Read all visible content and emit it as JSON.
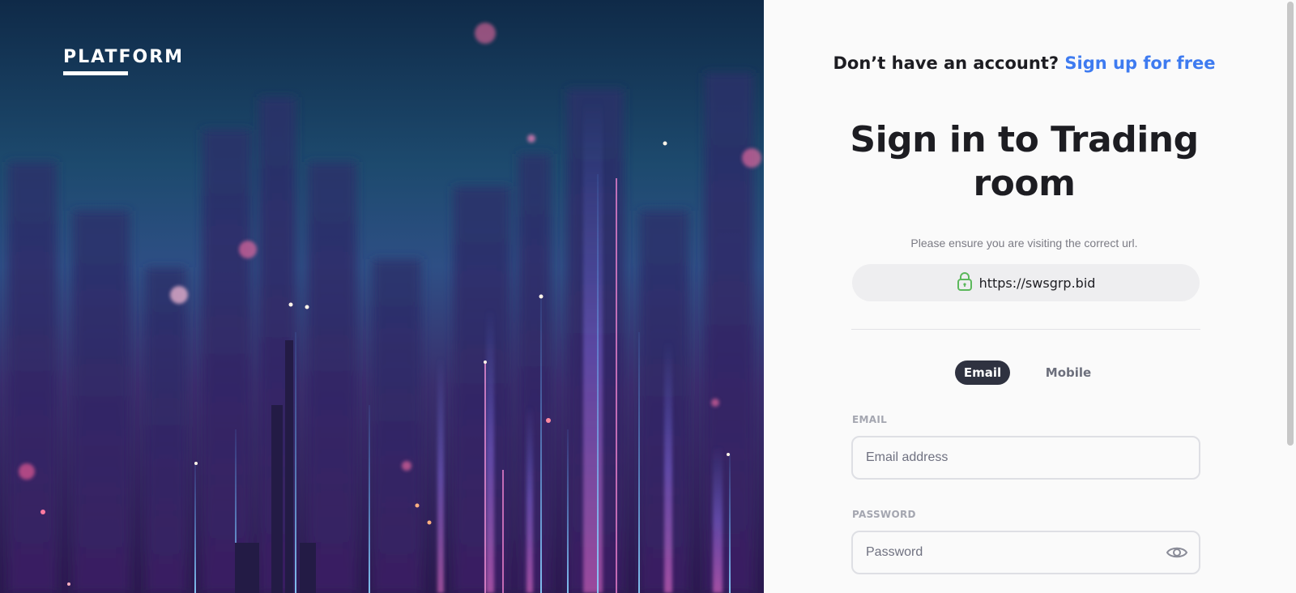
{
  "brand": {
    "logo_text": "PLATFORM"
  },
  "auth": {
    "prompt": "Don’t have an account?",
    "signup_link": "Sign up for free"
  },
  "heading": {
    "title_line1": "Sign in to Trading",
    "title_line2": "room"
  },
  "security": {
    "notice": "Please ensure you are visiting the correct url.",
    "url": "https://swsgrp.bid",
    "icon": "lock-icon"
  },
  "tabs": [
    {
      "label": "Email",
      "active": true
    },
    {
      "label": "Mobile",
      "active": false
    }
  ],
  "form": {
    "email_label": "EMAIL",
    "email_placeholder": "Email address",
    "email_value": "",
    "password_label": "PASSWORD",
    "password_placeholder": "Password",
    "password_value": "",
    "password_toggle_icon": "eye-icon"
  },
  "colors": {
    "accent": "#3e7bf0",
    "tab_active_bg": "#2f3240",
    "lock_green": "#5cb85c"
  }
}
